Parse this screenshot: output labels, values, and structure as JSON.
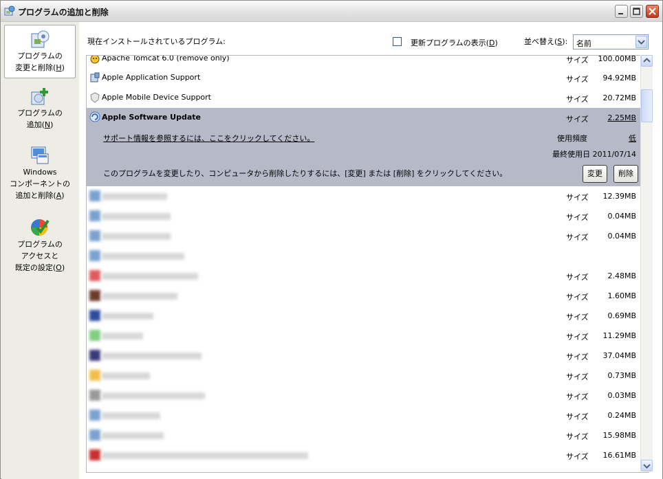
{
  "window": {
    "title": "プログラムの追加と削除"
  },
  "sidebar": {
    "items": [
      {
        "label": "プログラムの変更と削除(H)",
        "line1": "プログラムの",
        "line2": "変更と削除(",
        "key": "H",
        "tail": ")"
      },
      {
        "label": "プログラムの追加(N)",
        "line1": "プログラムの",
        "line2": "追加(",
        "key": "N",
        "tail": ")"
      },
      {
        "label": "Windowsコンポーネントの追加と削除(A)",
        "line1": "Windows",
        "line2": "コンポーネントの",
        "line3": "追加と削除(",
        "key": "A",
        "tail": ")"
      },
      {
        "label": "プログラムのアクセスと既定の設定(O)",
        "line1": "プログラムの",
        "line2": "アクセスと",
        "line3": "既定の設定(",
        "key": "O",
        "tail": ")"
      }
    ]
  },
  "header": {
    "installed_label": "現在インストールされているプログラム:",
    "show_updates_label": "更新プログラムの表示(D)",
    "show_updates_text": "更新プログラムの表示(",
    "show_updates_key": "D",
    "sort_label_text": "並べ替え(",
    "sort_label_key": "S",
    "sort_label_tail": "):",
    "sort_value": "名前",
    "paren_close": ")"
  },
  "programs": [
    {
      "name": "Apache Tomcat 6.0 (remove only)",
      "size_label": "サイズ",
      "size": "100.00MB"
    },
    {
      "name": "Apple Application Support",
      "size_label": "サイズ",
      "size": "94.92MB"
    },
    {
      "name": "Apple Mobile Device Support",
      "size_label": "サイズ",
      "size": "20.72MB"
    }
  ],
  "selected": {
    "name": "Apple Software Update",
    "size_label": "サイズ",
    "size": "2.25MB",
    "support_link": "サポート情報を参照するには、ここをクリックしてください。",
    "frequency_label": "使用頻度",
    "frequency": "低",
    "last_used": "最終使用日 2011/07/14",
    "description": "このプログラムを変更したり、コンピュータから削除したりするには、[変更] または [削除] をクリックしてください。",
    "change_button": "変更",
    "remove_button": "削除"
  },
  "blurred_rows": [
    {
      "size_label": "サイズ",
      "size": "12.39MB"
    },
    {
      "size_label": "サイズ",
      "size": "0.04MB"
    },
    {
      "size_label": "サイズ",
      "size": "0.04MB"
    },
    {
      "size_label": "",
      "size": ""
    },
    {
      "size_label": "サイズ",
      "size": "2.48MB"
    },
    {
      "size_label": "サイズ",
      "size": "1.60MB"
    },
    {
      "size_label": "サイズ",
      "size": "0.69MB"
    },
    {
      "size_label": "サイズ",
      "size": "11.29MB"
    },
    {
      "size_label": "サイズ",
      "size": "37.04MB"
    },
    {
      "size_label": "サイズ",
      "size": "0.73MB"
    },
    {
      "size_label": "サイズ",
      "size": "0.03MB"
    },
    {
      "size_label": "サイズ",
      "size": "0.24MB"
    },
    {
      "size_label": "サイズ",
      "size": "15.98MB"
    },
    {
      "size_label": "サイズ",
      "size": "16.61MB"
    }
  ],
  "colors": {
    "selection": "#b6b9c8",
    "sidebar": "#eeede5",
    "close_button": "#c3381c"
  }
}
